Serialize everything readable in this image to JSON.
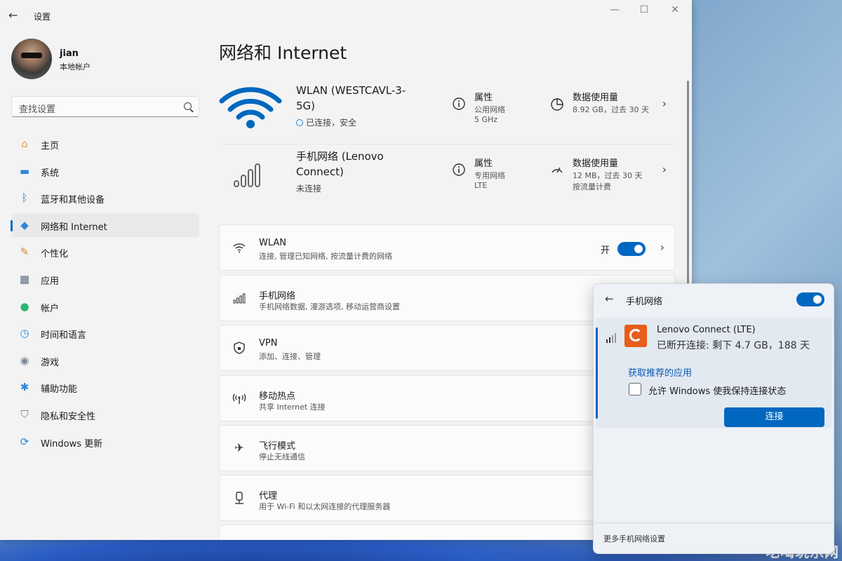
{
  "window": {
    "title": "设置",
    "minimize": "—",
    "maximize": "☐",
    "close": "✕",
    "back": "←"
  },
  "user": {
    "name": "jian",
    "type": "本地帐户"
  },
  "search": {
    "placeholder": "查找设置"
  },
  "nav": [
    {
      "label": "主页",
      "icon": "home-icon",
      "glyph": "⌂",
      "color": "#e0a24a"
    },
    {
      "label": "系统",
      "icon": "system-icon",
      "glyph": "▬",
      "color": "#2b88d8"
    },
    {
      "label": "蓝牙和其他设备",
      "icon": "bluetooth-icon",
      "glyph": "ᛒ",
      "color": "#2b88d8"
    },
    {
      "label": "网络和 Internet",
      "icon": "wifi-icon",
      "glyph": "◆",
      "color": "#2b88d8",
      "active": true
    },
    {
      "label": "个性化",
      "icon": "brush-icon",
      "glyph": "✎",
      "color": "#d9822b"
    },
    {
      "label": "应用",
      "icon": "apps-icon",
      "glyph": "▦",
      "color": "#5b6b80"
    },
    {
      "label": "帐户",
      "icon": "account-icon",
      "glyph": "●",
      "color": "#2bb673"
    },
    {
      "label": "时间和语言",
      "icon": "clock-globe-icon",
      "glyph": "◷",
      "color": "#2b88d8"
    },
    {
      "label": "游戏",
      "icon": "gamepad-icon",
      "glyph": "◉",
      "color": "#7a8594"
    },
    {
      "label": "辅助功能",
      "icon": "accessibility-icon",
      "glyph": "✱",
      "color": "#2b88d8"
    },
    {
      "label": "隐私和安全性",
      "icon": "shield-icon",
      "glyph": "⛉",
      "color": "#7a8594"
    },
    {
      "label": "Windows 更新",
      "icon": "update-icon",
      "glyph": "⟳",
      "color": "#2b88d8"
    }
  ],
  "main": {
    "title": "网络和 Internet",
    "wlan_hero": {
      "name": "WLAN (WESTCAVL-3-5G)",
      "status": "已连接，安全",
      "prop_title": "属性",
      "prop_line1": "公用网络",
      "prop_line2": "5 GHz",
      "usage_title": "数据使用量",
      "usage_line1": "8.92 GB，过去 30 天"
    },
    "cell_hero": {
      "name": "手机网络 (Lenovo Connect)",
      "status": "未连接",
      "prop_title": "属性",
      "prop_line1": "专用网络",
      "prop_line2": "LTE",
      "usage_title": "数据使用量",
      "usage_line1": "12 MB，过去 30 天",
      "usage_line2": "按流量计费"
    },
    "cards": [
      {
        "title": "WLAN",
        "sub": "连接, 管理已知网络, 按流量计费的网络",
        "toggle_label": "开"
      },
      {
        "title": "手机网络",
        "sub": "手机网络数据, 漫游选项, 移动运营商设置"
      },
      {
        "title": "VPN",
        "sub": "添加、连接、管理"
      },
      {
        "title": "移动热点",
        "sub": "共享 Internet 连接"
      },
      {
        "title": "飞行模式",
        "sub": "停止无线通信"
      },
      {
        "title": "代理",
        "sub": "用于 Wi-Fi 和以太网连接的代理服务器"
      }
    ]
  },
  "flyout": {
    "title": "手机网络",
    "network_name": "Lenovo Connect (LTE)",
    "network_status": "已断开连接: 剩下 4.7 GB，188 天",
    "link": "获取推荐的应用",
    "checkbox_label": "允许 Windows 使我保持连接状态",
    "connect_button": "连接",
    "footer": "更多手机网络设置"
  },
  "watermark": "吃喝玩乐网",
  "colors": {
    "accent": "#0067c0",
    "window_bg": "#f3f3f3",
    "card_bg": "#fbfbfb"
  }
}
